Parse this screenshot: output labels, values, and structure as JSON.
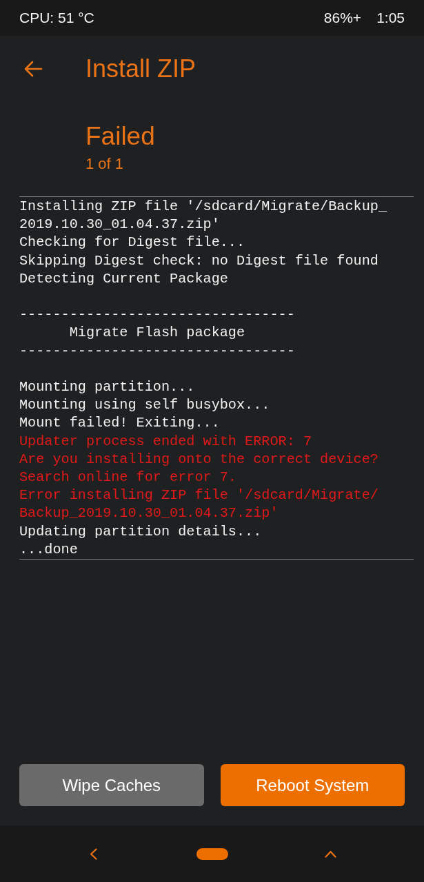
{
  "status_bar": {
    "sensor": "CPU: 51 °C",
    "battery": "86%+",
    "time": "1:05"
  },
  "header": {
    "title": "Install ZIP"
  },
  "progress": {
    "status": "Failed",
    "count": "1 of 1"
  },
  "log": {
    "blocks": [
      [
        {
          "kind": "info",
          "text": "Installing ZIP file '/sdcard/Migrate/Backup_"
        },
        {
          "kind": "info",
          "text": "2019.10.30_01.04.37.zip'"
        },
        {
          "kind": "info",
          "text": "Checking for Digest file..."
        },
        {
          "kind": "info",
          "text": "Skipping Digest check: no Digest file found"
        },
        {
          "kind": "info",
          "text": "Detecting Current Package"
        }
      ],
      [
        {
          "kind": "info",
          "text": "---------------------------------"
        },
        {
          "kind": "info",
          "text": "      Migrate Flash package"
        },
        {
          "kind": "info",
          "text": "---------------------------------"
        }
      ],
      [
        {
          "kind": "info",
          "text": "Mounting partition..."
        },
        {
          "kind": "info",
          "text": "Mounting using self busybox..."
        },
        {
          "kind": "info",
          "text": "Mount failed! Exiting..."
        },
        {
          "kind": "error",
          "text": "Updater process ended with ERROR: 7"
        },
        {
          "kind": "error",
          "text": "Are you installing onto the correct device?"
        },
        {
          "kind": "error",
          "text": "Search online for error 7."
        },
        {
          "kind": "error",
          "text": "Error installing ZIP file '/sdcard/Migrate/"
        },
        {
          "kind": "error",
          "text": "Backup_2019.10.30_01.04.37.zip'"
        },
        {
          "kind": "info",
          "text": "Updating partition details..."
        },
        {
          "kind": "info",
          "text": "...done"
        }
      ]
    ]
  },
  "buttons": [
    {
      "kind": "secondary",
      "label": "Wipe Caches"
    },
    {
      "kind": "primary",
      "label": "Reboot System"
    }
  ]
}
